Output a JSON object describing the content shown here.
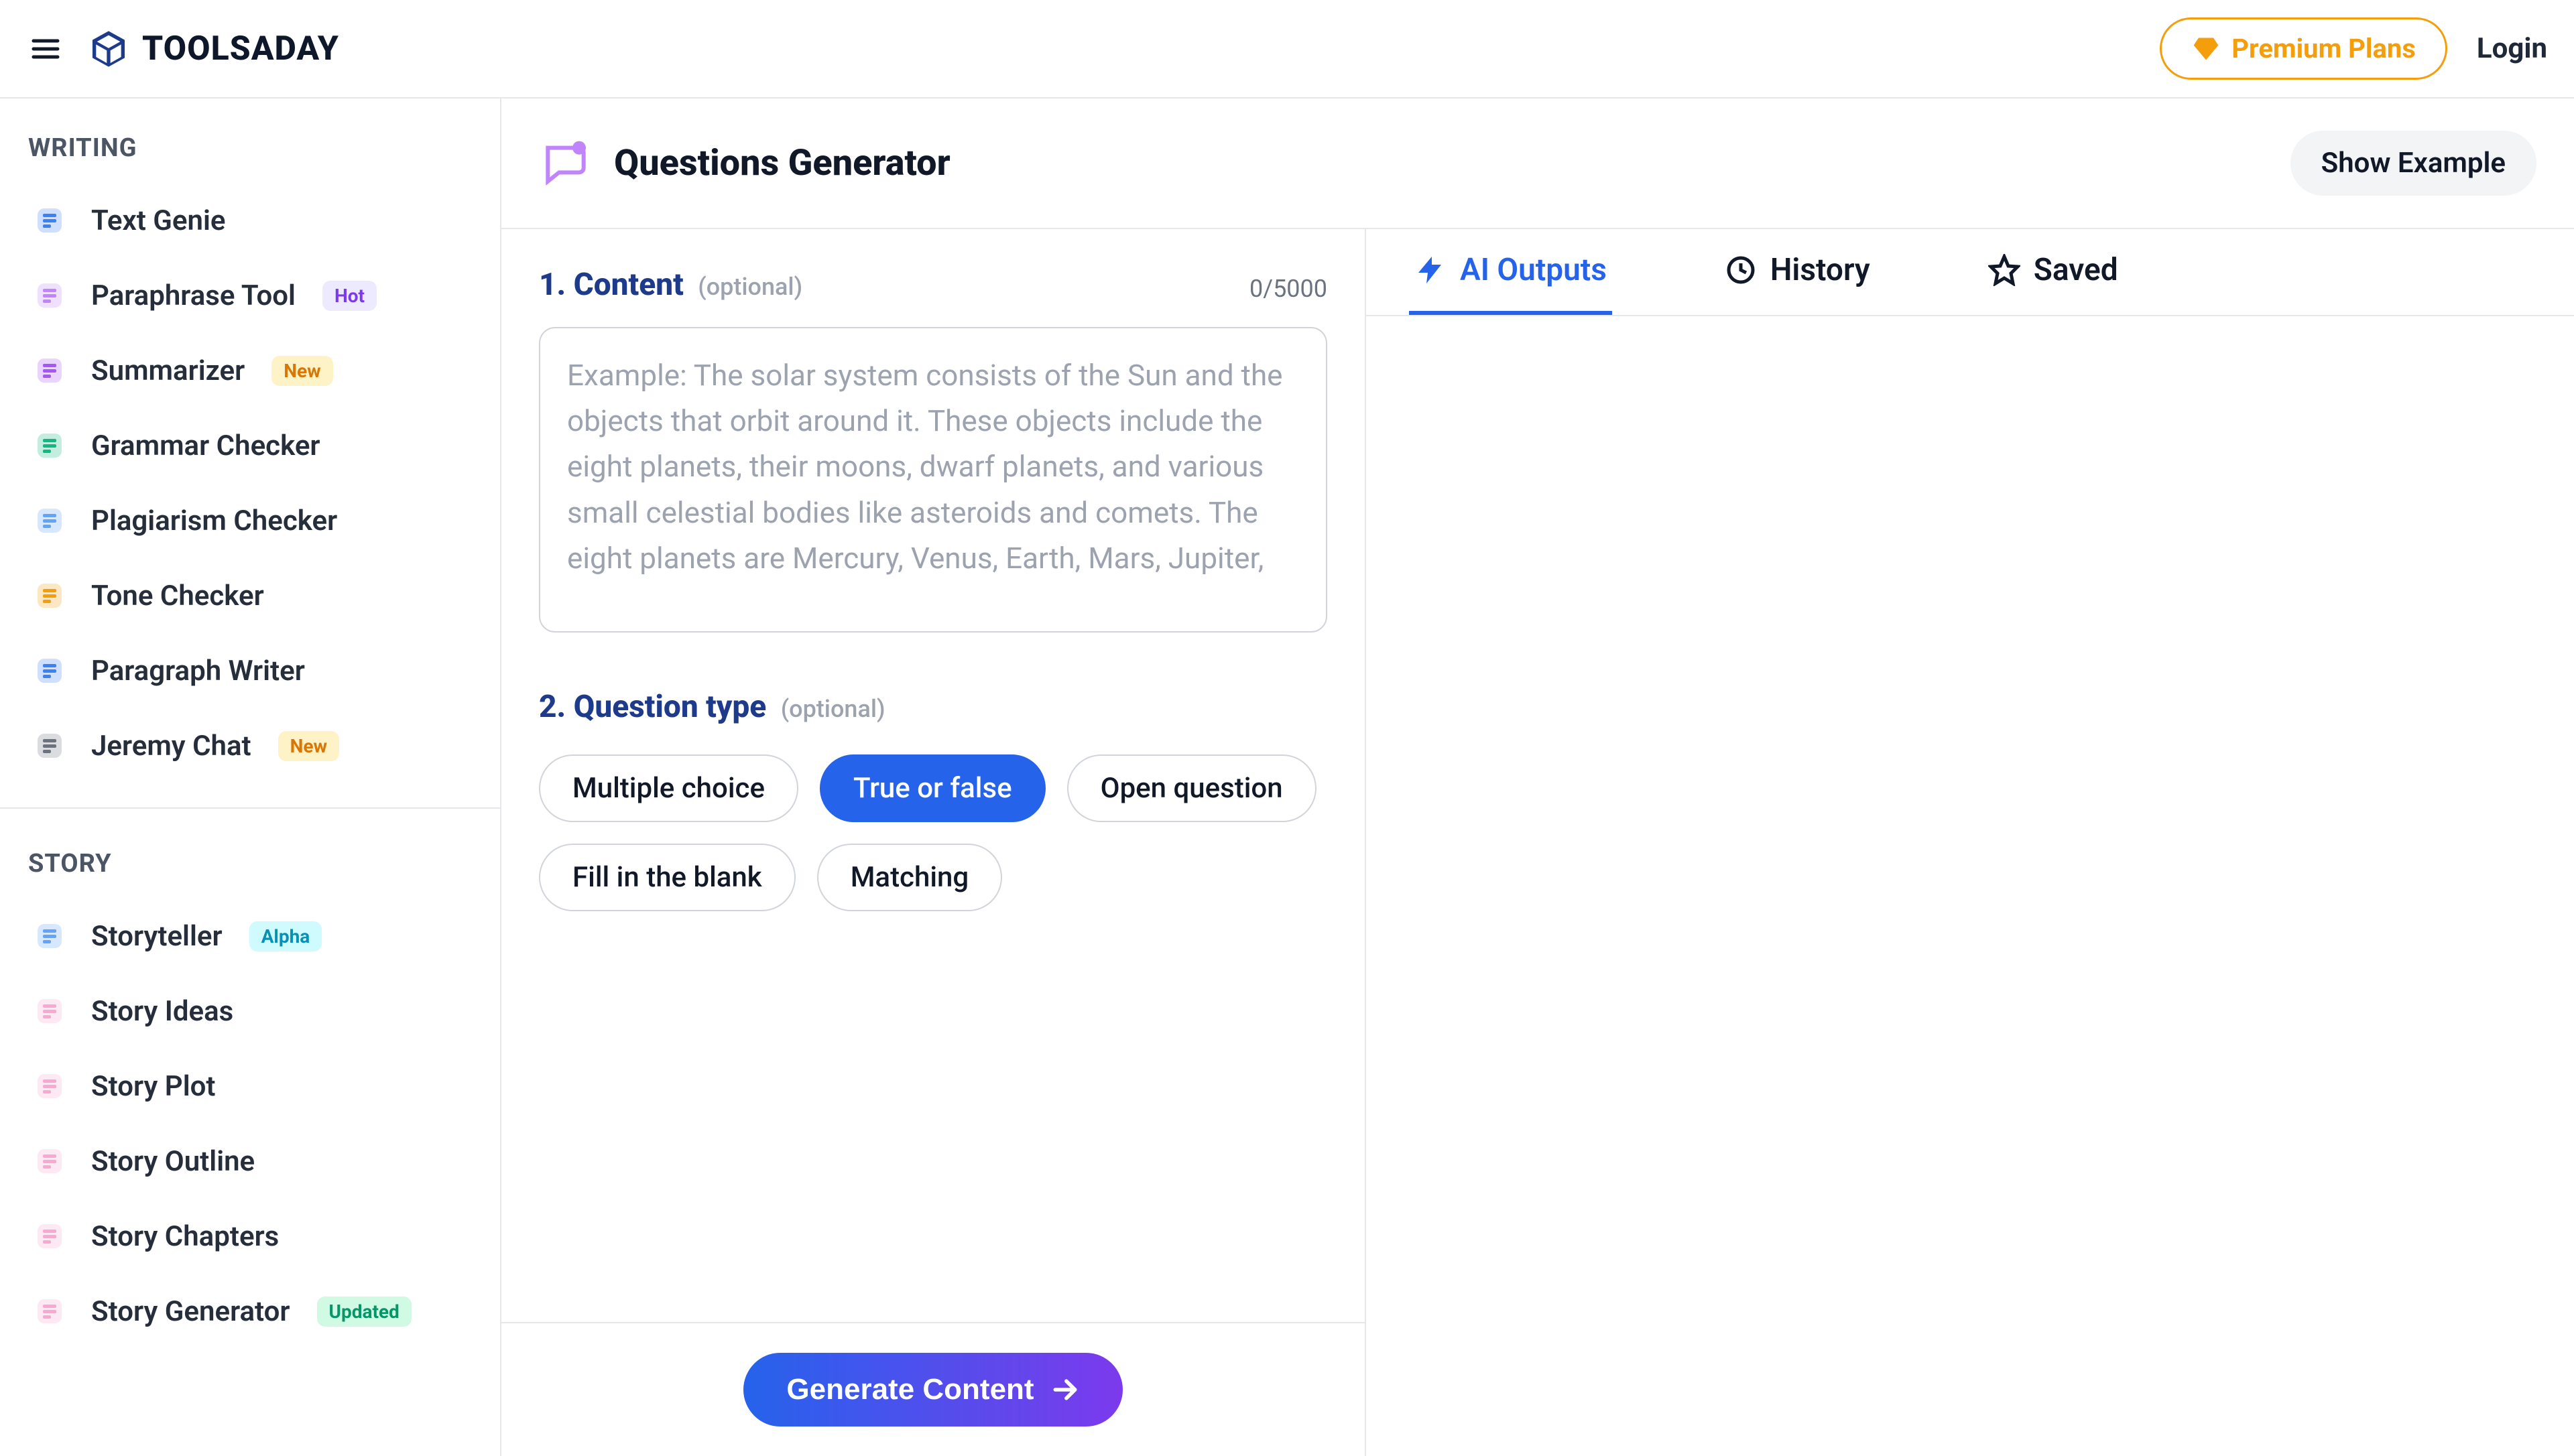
{
  "header": {
    "brand": "TOOLSADAY",
    "premium_label": "Premium Plans",
    "login_label": "Login"
  },
  "sidebar": {
    "section1_title": "WRITING",
    "section2_title": "STORY",
    "writing": [
      {
        "label": "Text Genie",
        "badge": null,
        "icon_color": "#3b82f6"
      },
      {
        "label": "Paraphrase Tool",
        "badge": "Hot",
        "badge_class": "badge-hot",
        "icon_color": "#c084fc"
      },
      {
        "label": "Summarizer",
        "badge": "New",
        "badge_class": "badge-new",
        "icon_color": "#a855f7"
      },
      {
        "label": "Grammar Checker",
        "badge": null,
        "icon_color": "#10b981"
      },
      {
        "label": "Plagiarism Checker",
        "badge": null,
        "icon_color": "#60a5fa"
      },
      {
        "label": "Tone Checker",
        "badge": null,
        "icon_color": "#f59e0b"
      },
      {
        "label": "Paragraph Writer",
        "badge": null,
        "icon_color": "#3b82f6"
      },
      {
        "label": "Jeremy Chat",
        "badge": "New",
        "badge_class": "badge-new",
        "icon_color": "#6b7280"
      }
    ],
    "story": [
      {
        "label": "Storyteller",
        "badge": "Alpha",
        "badge_class": "badge-alpha",
        "icon_color": "#60a5fa"
      },
      {
        "label": "Story Ideas",
        "badge": null,
        "icon_color": "#f9a8d4"
      },
      {
        "label": "Story Plot",
        "badge": null,
        "icon_color": "#f9a8d4"
      },
      {
        "label": "Story Outline",
        "badge": null,
        "icon_color": "#f9a8d4"
      },
      {
        "label": "Story Chapters",
        "badge": null,
        "icon_color": "#f9a8d4"
      },
      {
        "label": "Story Generator",
        "badge": "Updated",
        "badge_class": "badge-upd",
        "icon_color": "#f9a8d4"
      }
    ]
  },
  "page": {
    "title": "Questions Generator",
    "show_example": "Show Example"
  },
  "form": {
    "content": {
      "label": "1. Content",
      "optional": "(optional)",
      "counter": "0/5000",
      "placeholder": "Example: The solar system consists of the Sun and the objects that orbit around it. These objects include the eight planets, their moons, dwarf planets, and various small celestial bodies like asteroids and comets. The eight planets are Mercury, Venus, Earth, Mars, Jupiter,",
      "value": ""
    },
    "qtype": {
      "label": "2. Question type",
      "optional": "(optional)",
      "options": [
        "Multiple choice",
        "True or false",
        "Open question",
        "Fill in the blank",
        "Matching"
      ],
      "selected": "True or false"
    },
    "generate_label": "Generate Content"
  },
  "tabs": {
    "items": [
      {
        "label": "AI Outputs",
        "icon": "bolt"
      },
      {
        "label": "History",
        "icon": "clock"
      },
      {
        "label": "Saved",
        "icon": "star"
      }
    ],
    "active": "AI Outputs"
  }
}
